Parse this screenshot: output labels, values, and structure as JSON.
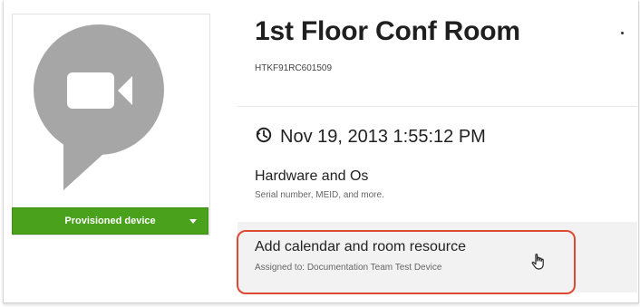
{
  "device": {
    "name": "1st Floor Conf Room",
    "serial": "HTKF91RC601509",
    "status_button": "Provisioned device",
    "avatar_icon": "video-camera-icon"
  },
  "details": {
    "last_sync_icon": "history-clock-icon",
    "last_sync": "Nov 19, 2013 1:55:12 PM",
    "hardware_title": "Hardware and Os",
    "hardware_subtitle": "Serial number, MEID, and more.",
    "resource_title": "Add calendar and room resource",
    "resource_subtitle": "Assigned to: Documentation Team Test Device"
  },
  "colors": {
    "accent_green": "#4aa11c",
    "highlight_red": "#dd4a31",
    "avatar_gray": "#a6a6a6"
  }
}
